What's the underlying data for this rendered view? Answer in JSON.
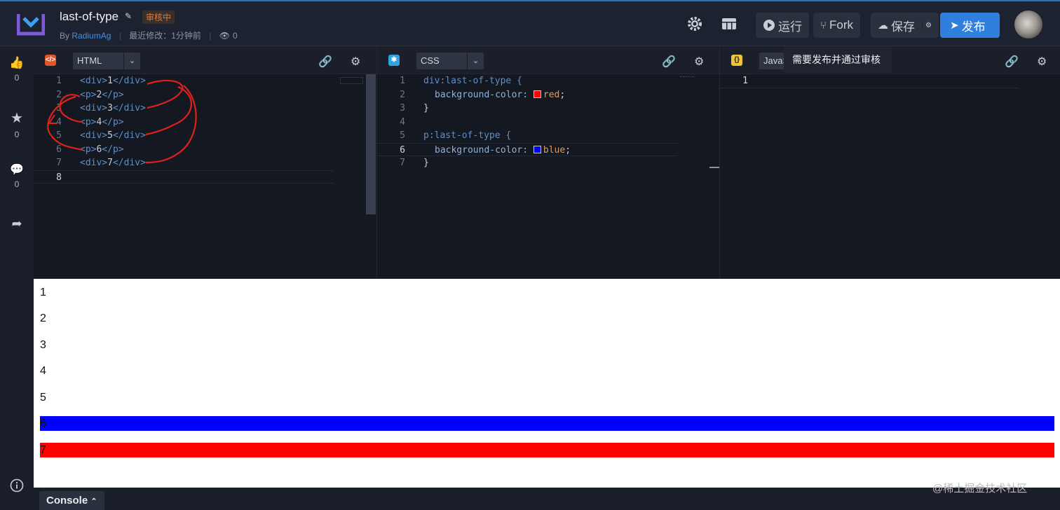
{
  "header": {
    "title": "last-of-type",
    "badge": "审核中",
    "meta_by": "By",
    "meta_user": "RadiumAg",
    "meta_modified": "最近修改：1分钟前",
    "meta_views": "0",
    "run_label": "运行",
    "fork_label": "Fork",
    "save_label": "保存",
    "publish_label": "发布",
    "accent_color": "#2f7fde"
  },
  "rail": {
    "like_count": "0",
    "star_count": "0",
    "comment_count": "0"
  },
  "panes": {
    "html": {
      "language": "HTML",
      "lines": [
        {
          "n": "1",
          "open": "<div>",
          "text": "1",
          "close": "</div>"
        },
        {
          "n": "2",
          "open": "<p>",
          "text": "2",
          "close": "</p>"
        },
        {
          "n": "3",
          "open": "<div>",
          "text": "3",
          "close": "</div>"
        },
        {
          "n": "4",
          "open": "<p>",
          "text": "4",
          "close": "</p>"
        },
        {
          "n": "5",
          "open": "<div>",
          "text": "5",
          "close": "</div>"
        },
        {
          "n": "6",
          "open": "<p>",
          "text": "6",
          "close": "</p>"
        },
        {
          "n": "7",
          "open": "<div>",
          "text": "7",
          "close": "</div>"
        },
        {
          "n": "8",
          "open": "",
          "text": "",
          "close": ""
        }
      ]
    },
    "css": {
      "language": "CSS",
      "selector1": "div:last-of-type {",
      "prop1": "background-color: ",
      "val1": "red",
      "swatch1_color": "#ff0000",
      "close1": "}",
      "selector2": "p:last-of-type {",
      "prop2": "background-color: ",
      "val2": "blue",
      "swatch2_color": "#0000ff",
      "close2": "}",
      "line_numbers": [
        "1",
        "2",
        "3",
        "4",
        "5",
        "6",
        "7"
      ]
    },
    "js": {
      "language": "JavaS",
      "line_numbers": [
        "1"
      ]
    }
  },
  "tooltip": "需要发布并通过审核",
  "preview": {
    "rows": [
      {
        "text": "1",
        "bg": "#ffffff"
      },
      {
        "text": "2",
        "bg": "#ffffff"
      },
      {
        "text": "3",
        "bg": "#ffffff"
      },
      {
        "text": "4",
        "bg": "#ffffff"
      },
      {
        "text": "5",
        "bg": "#ffffff"
      },
      {
        "text": "6",
        "bg": "#0000ff"
      },
      {
        "text": "7",
        "bg": "#ff0000"
      }
    ]
  },
  "console_label": "Console",
  "watermark": "@稀土掘金技术社区"
}
